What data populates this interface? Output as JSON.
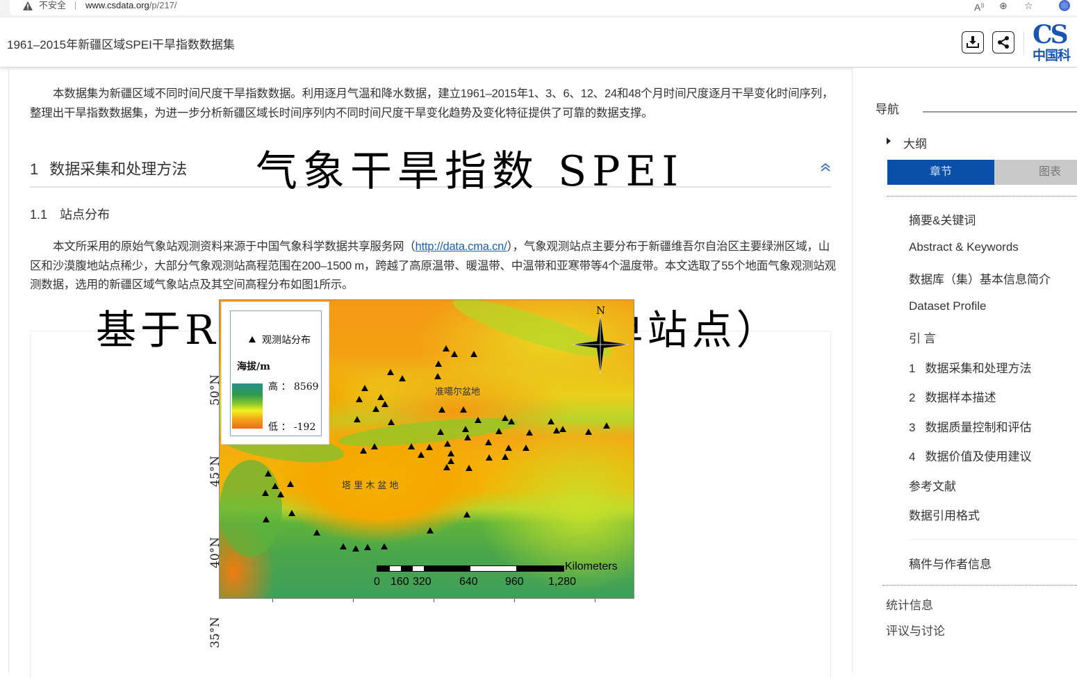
{
  "browser": {
    "security_label": "不安全",
    "url_host": "www.csdata.org",
    "url_path": "/p/217/",
    "icons": [
      "warning-icon",
      "read-aloud-icon",
      "zoom-icon",
      "favorites-icon",
      "profile-icon"
    ]
  },
  "header": {
    "title": "1961–2015年新疆区域SPEI干旱指数数据集",
    "download_label": "download",
    "share_label": "share",
    "logo_text_top": "CS",
    "logo_text_bottom": "中国科"
  },
  "main": {
    "abstract": "本数据集为新疆区域不同时间尺度干旱指数数据。利用逐月气温和降水数据，建立1961–2015年1、3、6、12、24和48个月时间尺度逐月干旱变化时间序列，整理出干旱指数数据集，为进一步分析新疆区域长时间序列内不同时间尺度干旱变化趋势及变化特征提供了可靠的数据支撑。",
    "section": {
      "num": "1",
      "title": "数据采集和处理方法"
    },
    "subsection": {
      "num": "1.1",
      "title": "站点分布"
    },
    "para_before_link": "本文所采用的原始气象站观测资料来源于中国气象科学数据共享服务网（",
    "link_text": "http://data.cma.cn/",
    "para_after_link": "），气象观测站点主要分布于新疆维吾尔自治区主要绿洲区域，山区和沙漠腹地站点稀少，大部分气象观测站高程范围在200–1500 m，跨越了高原温带、暖温带、中温带和亚寒带等4个温度带。本文选取了55个地面气象观测站观测数据，选用的新疆区域气象站点及其空间高程分布如图1所示。",
    "overlay_title_1": "气象干旱指数 SPEI",
    "overlay_title_2": "基于R语言的SPEI教程（单站点）"
  },
  "map": {
    "legend": {
      "station_label": "观测站分布",
      "elevation_label": "海拔/m",
      "high_label": "高 ： 8569",
      "low_label": "低 ： -192"
    },
    "basins": {
      "junggar": "准噶尔盆地",
      "tarim": "塔 里 木 盆 地"
    },
    "north_label": "N",
    "lat_labels": [
      "50°N",
      "45°N",
      "40°N",
      "35°N"
    ],
    "scale": {
      "unit": "Kilometers",
      "ticks": [
        "0",
        "160",
        "320",
        "640",
        "960",
        "1,280"
      ]
    },
    "colors": {
      "high": "#2a8f8a",
      "mid": "#f0f020",
      "low": "#ef6b12"
    }
  },
  "sidebar": {
    "nav_title": "导航",
    "outline_label": "大纲",
    "tabs": [
      {
        "label": "章节",
        "active": true
      },
      {
        "label": "图表",
        "active": false
      }
    ],
    "toc": [
      {
        "num": "",
        "label": "摘要&关键词"
      },
      {
        "num": "",
        "label": "Abstract & Keywords"
      },
      {
        "num": "",
        "label": "数据库（集）基本信息简介"
      },
      {
        "num": "",
        "label": "Dataset Profile"
      },
      {
        "num": "",
        "label": "引 言"
      },
      {
        "num": "1",
        "label": "数据采集和处理方法"
      },
      {
        "num": "2",
        "label": "数据样本描述"
      },
      {
        "num": "3",
        "label": "数据质量控制和评估"
      },
      {
        "num": "4",
        "label": "数据价值及使用建议"
      },
      {
        "num": "",
        "label": "参考文献"
      },
      {
        "num": "",
        "label": "数据引用格式"
      }
    ],
    "author_info": "稿件与作者信息",
    "extra": [
      "统计信息",
      "评议与讨论"
    ],
    "accent_color": "#0a4fa8"
  }
}
